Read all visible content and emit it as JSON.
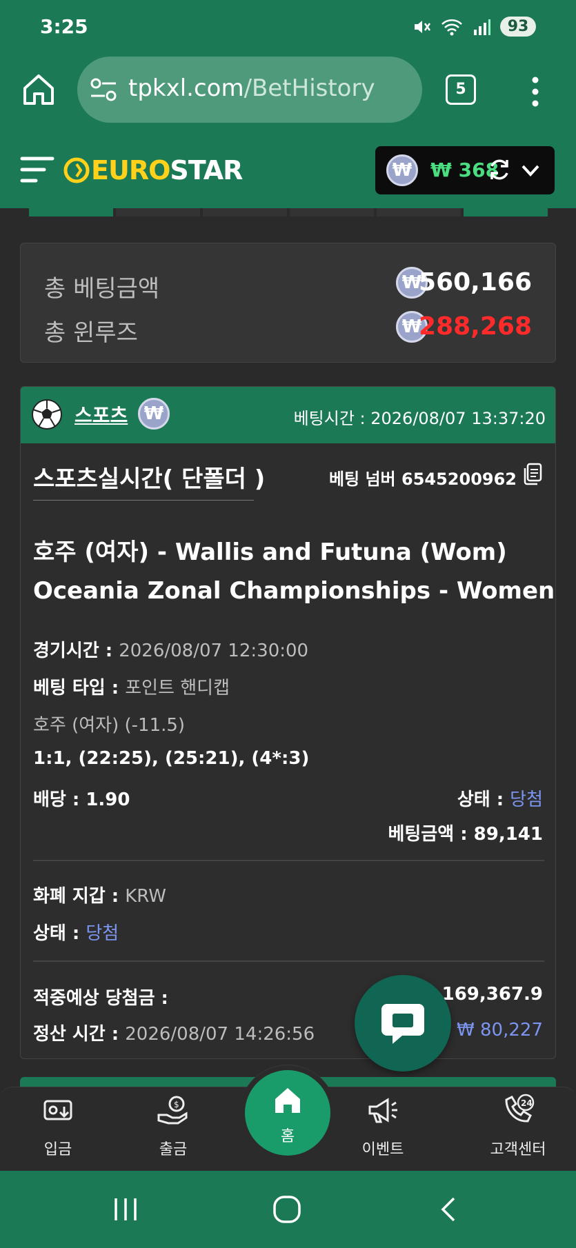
{
  "status_bar": {
    "time": "3:25",
    "battery": "93"
  },
  "browser": {
    "url_host": "tpkxl.com",
    "url_path": "/BetHistory",
    "tab_count": "5"
  },
  "site": {
    "logo_part1": "EURO",
    "logo_part2": "STAR",
    "currency_symbol": "₩",
    "wallet_balance": "₩ 368"
  },
  "totals": {
    "bet_label": "총 베팅금액",
    "bet_value": "560,166",
    "winloss_label": "총 윈루즈",
    "winloss_value": "288,268"
  },
  "bet": {
    "sport": "스포츠",
    "time_label": "베팅시간 : ",
    "time_value": "2026/08/07 13:37:20",
    "type": "스포츠실시간( 단폴더 )",
    "number_label": "베팅 넘버",
    "number_value": "6545200962",
    "match_title": "호주 (여자) - Wallis and Futuna (Wom)",
    "league": "Oceania Zonal Championships - Women",
    "game_time_label": "경기시간 : ",
    "game_time_value": "2026/08/07 12:30:00",
    "bet_type_label": "베팅 타입 : ",
    "bet_type_value": "포인트 핸디캡",
    "selection": "호주 (여자) (-11.5)",
    "score": "1:1, (22:25), (25:21), (4*:3)",
    "odds_label": "배당 : ",
    "odds_value": "1.90",
    "status_label": "상태 : ",
    "status_value": "당첨",
    "stake_label": "베팅금액 : ",
    "stake_value": "89,141",
    "wallet_label": "화폐 지갑 : ",
    "wallet_value": "KRW",
    "status2_label": "상태 : ",
    "status2_value": "당첨",
    "expected_win_label": "적중예상 당첨금 :",
    "expected_win_value": "169,367.9",
    "settle_label": "정산 시간 : ",
    "settle_value": "2026/08/07 14:26:56",
    "settle_amount": "₩ 80,227"
  },
  "bottom_nav": {
    "deposit": "입금",
    "withdraw": "출금",
    "home": "홈",
    "event": "이벤트",
    "support": "고객센터"
  },
  "colors": {
    "brand_green": "#1b7a55",
    "logo_yellow": "#ffd11a",
    "loss_red": "#ff2a2a",
    "status_blue": "#7b95f0",
    "wallet_green": "#4ade80"
  }
}
